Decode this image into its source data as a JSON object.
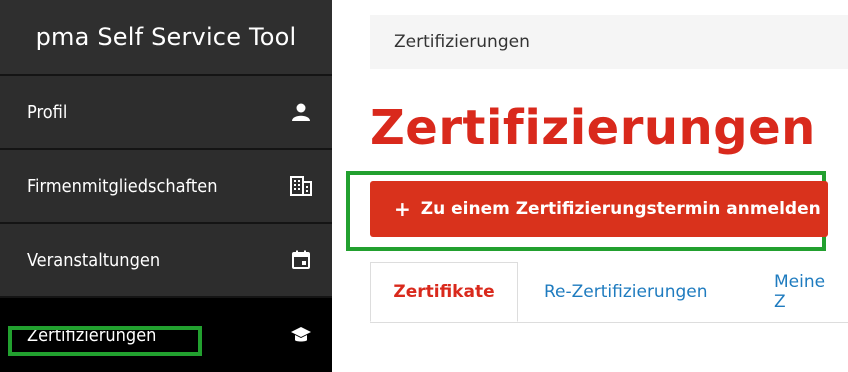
{
  "sidebar": {
    "app_title": "pma Self Service Tool",
    "items": [
      {
        "label": "Profil",
        "icon": "person-icon"
      },
      {
        "label": "Firmenmitgliedschaften",
        "icon": "building-icon"
      },
      {
        "label": "Veranstaltungen",
        "icon": "calendar-icon"
      },
      {
        "label": "Zertifizierungen",
        "icon": "graduation-cap-icon",
        "active": true
      }
    ]
  },
  "main": {
    "breadcrumb": "Zertifizierungen",
    "title": "Zertifizierungen",
    "cta": {
      "plus": "+",
      "label": "Zu einem Zertifizierungstermin anmelden"
    },
    "tabs": [
      {
        "label": "Zertifikate",
        "active": true
      },
      {
        "label": "Re-Zertifizierungen"
      },
      {
        "label": "Meine Z"
      }
    ]
  },
  "colors": {
    "accent": "#d9291c",
    "sidebar": "#2d2d2d",
    "highlight": "#22a02f",
    "link": "#1e7bbf"
  }
}
